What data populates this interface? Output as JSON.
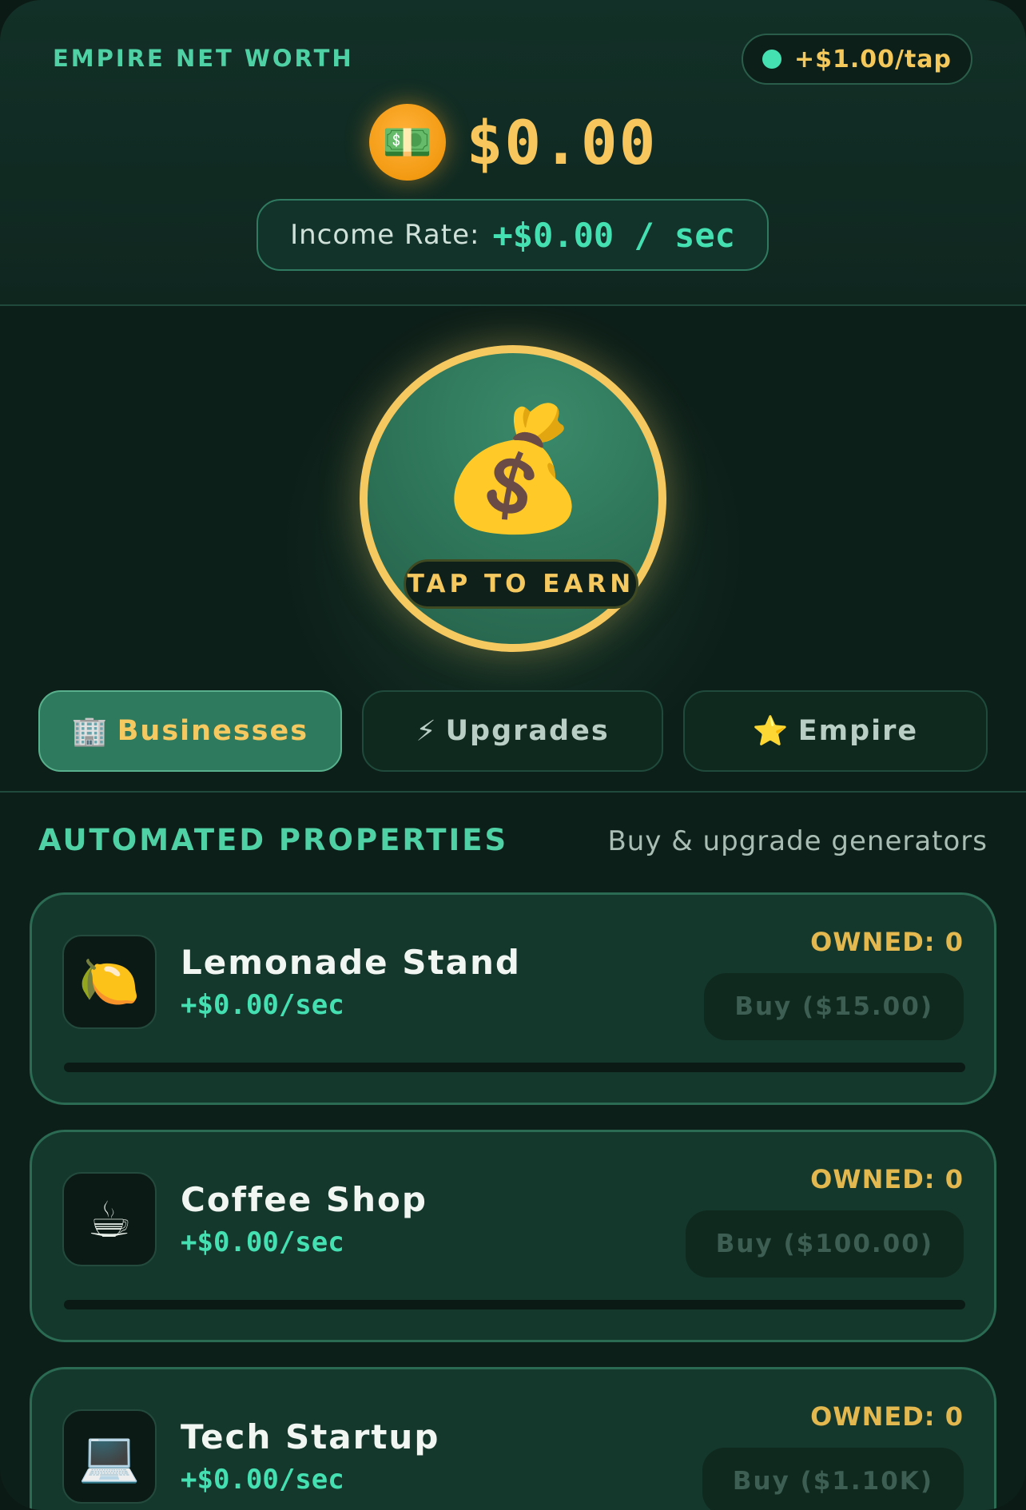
{
  "header": {
    "net_worth_label": "EMPIRE NET WORTH",
    "tap_rate": "+$1.00/tap",
    "coin_icon": "💵",
    "balance": "$0.00",
    "income_label": "Income Rate:",
    "income_value": "+$0.00 / sec"
  },
  "tap_button": {
    "icon": "💰",
    "label": "TAP TO EARN"
  },
  "tabs": [
    {
      "icon": "🏢",
      "label": "Businesses",
      "active": true
    },
    {
      "icon": "⚡",
      "label": "Upgrades",
      "active": false
    },
    {
      "icon": "⭐",
      "label": "Empire",
      "active": false
    }
  ],
  "section": {
    "title": "AUTOMATED PROPERTIES",
    "subtitle": "Buy & upgrade generators"
  },
  "businesses": [
    {
      "icon": "🍋",
      "name": "Lemonade Stand",
      "rate": "+$0.00/sec",
      "owned": "OWNED: 0",
      "buy_label": "Buy ($15.00)",
      "progress": 0
    },
    {
      "icon": "☕",
      "name": "Coffee Shop",
      "rate": "+$0.00/sec",
      "owned": "OWNED: 0",
      "buy_label": "Buy ($100.00)",
      "progress": 0
    },
    {
      "icon": "💻",
      "name": "Tech Startup",
      "rate": "+$0.00/sec",
      "owned": "OWNED: 0",
      "buy_label": "Buy ($1.10K)",
      "progress": 0
    }
  ],
  "colors": {
    "accent_green": "#45e0b2",
    "gold": "#f6c860",
    "background": "#0d1f19"
  }
}
